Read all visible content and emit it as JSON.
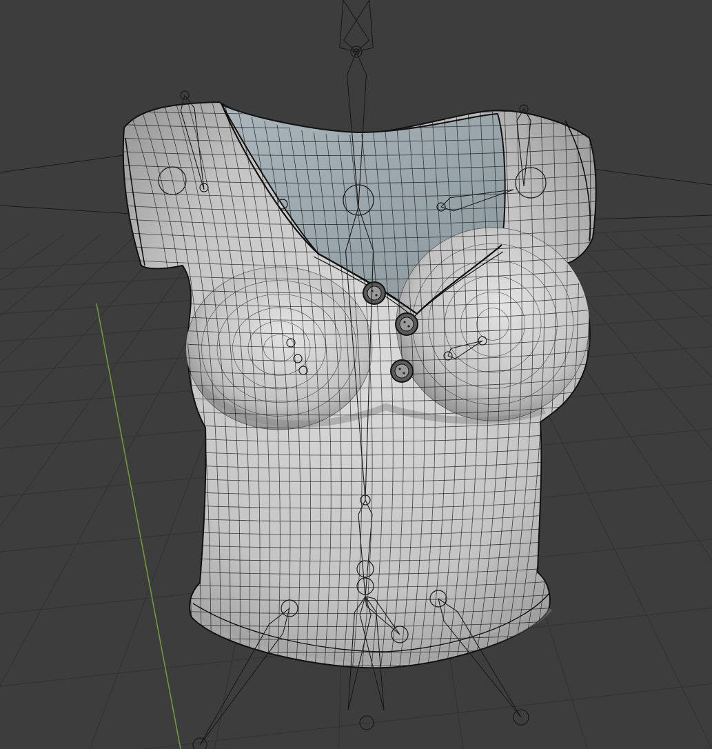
{
  "viewport": {
    "background": "#3d3d3d",
    "grid_line_color": "#333333",
    "y_axis_color": "#6e9b3a",
    "shading": "solid",
    "overlay": "wireframe",
    "show_floor_grid": true,
    "show_y_axis": true
  },
  "object": {
    "kind": "rigged garment mesh",
    "description_icon": "mesh-object-icon",
    "cloth_color": "#c8c8c8",
    "cloth_shadow_color": "#8d8d8d",
    "interior_color": "#9aa8ae",
    "wire_color": "#111111",
    "buttons": 3
  },
  "armature": {
    "icon": "armature-bone-icon",
    "bone_color": "#1a1a1a"
  }
}
